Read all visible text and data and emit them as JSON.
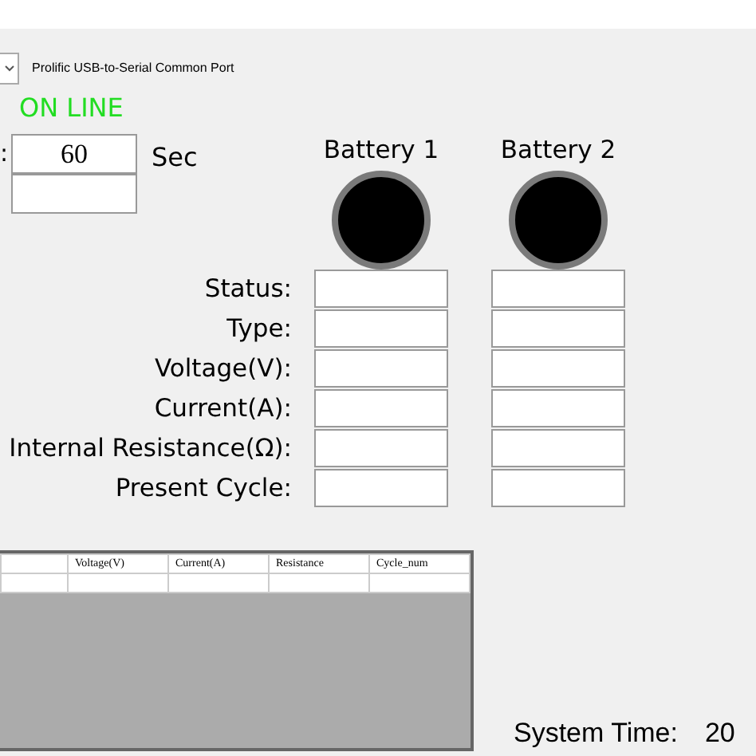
{
  "port": {
    "value": "Prolific USB-to-Serial Common Port"
  },
  "connection_status": "ON LINE",
  "interval": {
    "prefix": ":",
    "value": "60",
    "unit": "Sec"
  },
  "batteries": [
    {
      "name": "Battery 1",
      "color": "#000000"
    },
    {
      "name": "Battery 2",
      "color": "#000000"
    }
  ],
  "fields": [
    "Status:",
    "Type:",
    "Voltage(V):",
    "Current(A):",
    "Internal Resistance(Ω):",
    "Present Cycle:"
  ],
  "table": {
    "columns": [
      "Voltage(V)",
      "Current(A)",
      "Resistance",
      "Cycle_num"
    ]
  },
  "status_bar": {
    "label": "System Time:",
    "value": "20"
  }
}
